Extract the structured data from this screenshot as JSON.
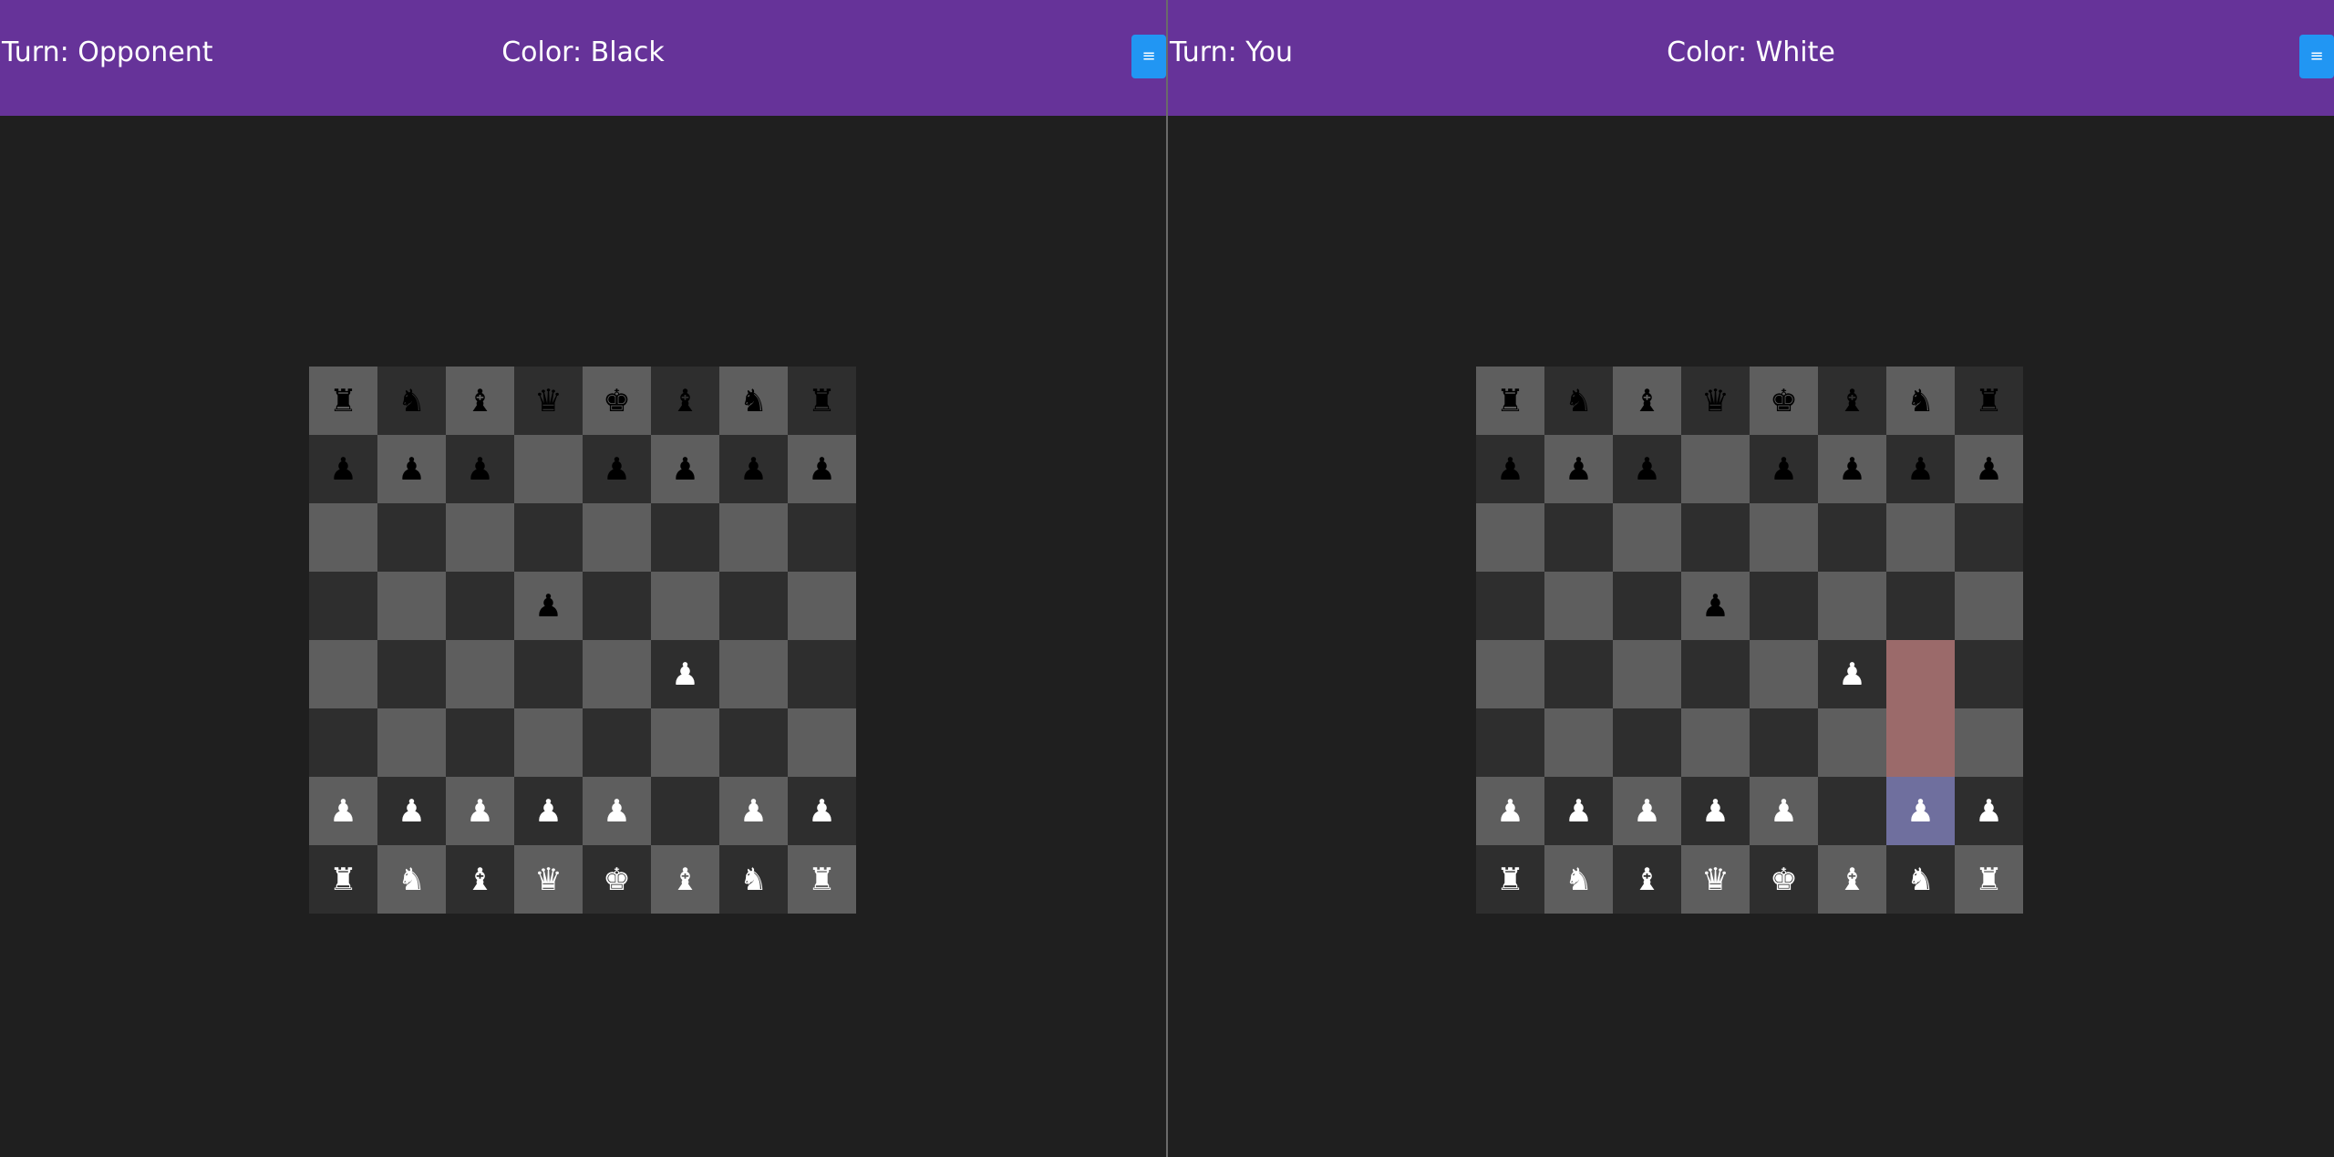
{
  "colors": {
    "header_bg": "#663399",
    "menu_button_bg": "#2196f3",
    "page_bg": "#1f1f1f",
    "light_square": "#5e5e5e",
    "dark_square": "#2e2e2e",
    "move_target": "#9b6a6a",
    "selected_square": "#6f6f9e"
  },
  "glyphs": {
    "wK": "♚",
    "wQ": "♛",
    "wR": "♜",
    "wB": "♝",
    "wN": "♞",
    "wP": "♟",
    "bK": "♚",
    "bQ": "♛",
    "bR": "♜",
    "bB": "♝",
    "bN": "♞",
    "bP": "♟"
  },
  "panes": [
    {
      "id": "left",
      "turn_label": "Turn: Opponent",
      "color_label": "Color: Black",
      "menu_label": "≡",
      "menu_icon": "hamburger-menu-icon",
      "board": [
        [
          "bR",
          "bN",
          "bB",
          "bQ",
          "bK",
          "bB",
          "bN",
          "bR"
        ],
        [
          "bP",
          "bP",
          "bP",
          "",
          "bP",
          "bP",
          "bP",
          "bP"
        ],
        [
          "",
          "",
          "",
          "",
          "",
          "",
          "",
          ""
        ],
        [
          "",
          "",
          "",
          "bP",
          "",
          "",
          "",
          ""
        ],
        [
          "",
          "",
          "",
          "",
          "",
          "wP",
          "",
          ""
        ],
        [
          "",
          "",
          "",
          "",
          "",
          "",
          "",
          ""
        ],
        [
          "wP",
          "wP",
          "wP",
          "wP",
          "wP",
          "",
          "wP",
          "wP"
        ],
        [
          "wR",
          "wN",
          "wB",
          "wQ",
          "wK",
          "wB",
          "wN",
          "wR"
        ]
      ],
      "highlights": {}
    },
    {
      "id": "right",
      "turn_label": "Turn: You",
      "color_label": "Color: White",
      "menu_label": "≡",
      "menu_icon": "hamburger-menu-icon",
      "board": [
        [
          "bR",
          "bN",
          "bB",
          "bQ",
          "bK",
          "bB",
          "bN",
          "bR"
        ],
        [
          "bP",
          "bP",
          "bP",
          "",
          "bP",
          "bP",
          "bP",
          "bP"
        ],
        [
          "",
          "",
          "",
          "",
          "",
          "",
          "",
          ""
        ],
        [
          "",
          "",
          "",
          "bP",
          "",
          "",
          "",
          ""
        ],
        [
          "",
          "",
          "",
          "",
          "",
          "wP",
          "",
          ""
        ],
        [
          "",
          "",
          "",
          "",
          "",
          "",
          "",
          ""
        ],
        [
          "wP",
          "wP",
          "wP",
          "wP",
          "wP",
          "",
          "wP",
          "wP"
        ],
        [
          "wR",
          "wN",
          "wB",
          "wQ",
          "wK",
          "wB",
          "wN",
          "wR"
        ]
      ],
      "highlights": {
        "selected": [
          "6,6"
        ],
        "move_targets": [
          "4,6",
          "5,6"
        ]
      }
    }
  ]
}
